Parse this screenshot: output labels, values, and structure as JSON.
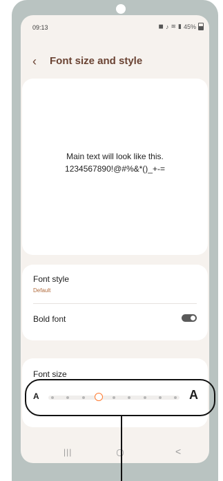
{
  "status_bar": {
    "time": "09:13",
    "battery": "45%"
  },
  "header": {
    "title": "Font size and style"
  },
  "preview": {
    "line1": "Main text will look like this.",
    "line2": "1234567890!@#%&*()_+-="
  },
  "font_style": {
    "label": "Font style",
    "value": "Default"
  },
  "bold_font": {
    "label": "Bold font",
    "enabled": false
  },
  "font_size": {
    "label": "Font size",
    "small_label": "A",
    "large_label": "A",
    "steps": 9,
    "selected_step": 3
  },
  "nav": {
    "recents": "|||",
    "back": "<"
  },
  "colors": {
    "accent": "#6a4333",
    "thumb": "#ff7a2f",
    "background": "#f6f2ee"
  }
}
